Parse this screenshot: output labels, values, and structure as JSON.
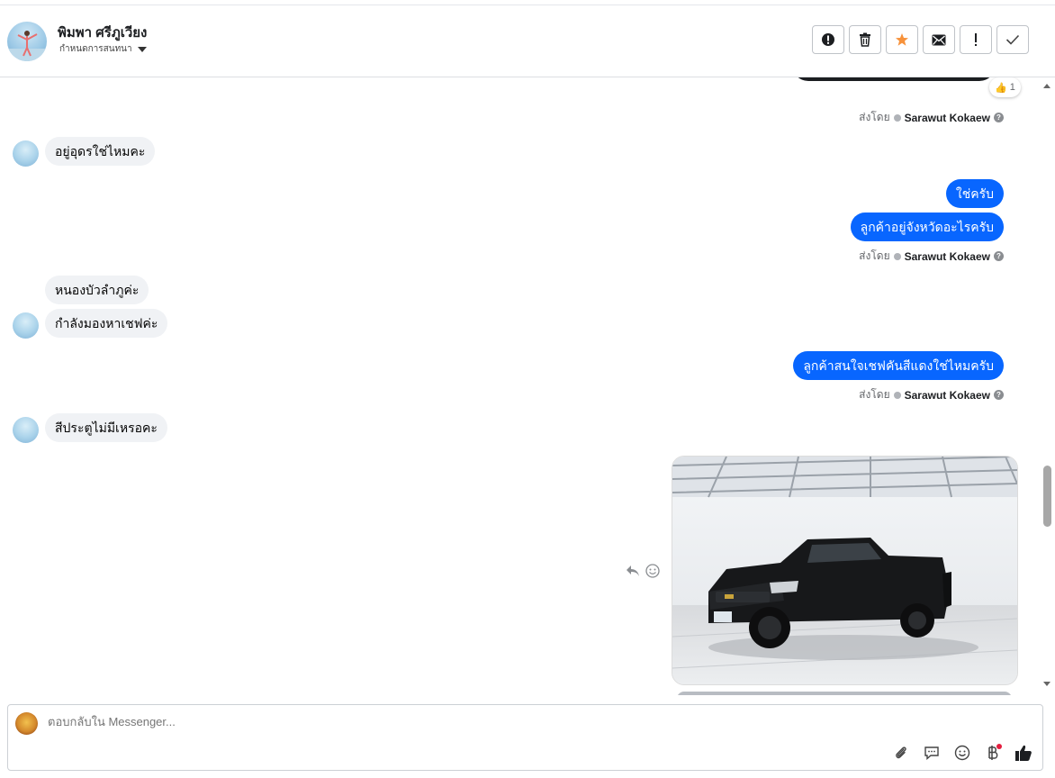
{
  "header": {
    "name": "พิมพา ศรีภูเวียง",
    "subtitle": "กำหนดการสนทนา",
    "actions": [
      "report-icon",
      "trash-icon",
      "star-icon",
      "envelope-icon",
      "exclamation-icon",
      "check-icon"
    ]
  },
  "reaction": {
    "emoji": "👍",
    "count": "1"
  },
  "sent_by": {
    "prefix": "ส่งโดย",
    "agent": "Sarawut Kokaew",
    "help": "?"
  },
  "messages": {
    "in1": "อยู่อุดรใช่ไหมคะ",
    "out1": "ใช่ครับ",
    "out2": "ลูกค้าอยู่จังหวัดอะไรครับ",
    "in2": "หนองบัวลำภูค่ะ",
    "in3": "กำลังมองหาเชฟค่ะ",
    "out3": "ลูกค้าสนใจเชฟคันสีแดงใช่ไหมครับ",
    "in4": "สีประตูไม่มีเหรอคะ"
  },
  "photo": {
    "subject": "black pickup truck in showroom"
  },
  "composer": {
    "placeholder": "ตอบกลับใน Messenger...",
    "tools": [
      "paperclip-icon",
      "comment-icon",
      "smiley-icon",
      "baht-icon",
      "thumbs-up-icon"
    ]
  },
  "colors": {
    "outgoing": "#0866ff",
    "incoming": "#f0f2f5",
    "accent_star": "#f7923b"
  }
}
